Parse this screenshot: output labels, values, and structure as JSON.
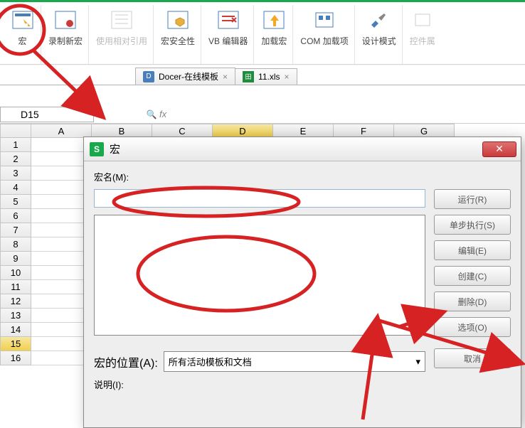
{
  "ribbon": {
    "items": [
      {
        "label": "宏"
      },
      {
        "label": "录制新宏"
      },
      {
        "label": "使用相对引用",
        "disabled": true
      },
      {
        "label": "宏安全性"
      },
      {
        "label": "VB 编辑器"
      },
      {
        "label": "加载宏"
      },
      {
        "label": "COM 加载项"
      },
      {
        "label": "设计模式"
      },
      {
        "label": "控件属",
        "disabled": true
      }
    ]
  },
  "tabs": {
    "t1": {
      "label": "Docer-在线模板",
      "close": "×"
    },
    "t2": {
      "label": "11.xls",
      "close": "×"
    }
  },
  "nameBox": "D15",
  "fx": "fx",
  "cols": [
    "A",
    "B",
    "C",
    "D",
    "E",
    "F",
    "G"
  ],
  "rows": [
    "1",
    "2",
    "3",
    "4",
    "5",
    "6",
    "7",
    "8",
    "9",
    "10",
    "11",
    "12",
    "13",
    "14",
    "15",
    "16"
  ],
  "dialog": {
    "title": "宏",
    "macroNameLabel": "宏名(M):",
    "buttons": {
      "run": "运行(R)",
      "step": "单步执行(S)",
      "edit": "编辑(E)",
      "create": "创建(C)",
      "delete": "删除(D)",
      "options": "选项(O)",
      "cancel": "取消"
    },
    "locationLabel": "宏的位置(A):",
    "locationValue": "所有活动模板和文档",
    "descLabel": "说明(I):"
  }
}
